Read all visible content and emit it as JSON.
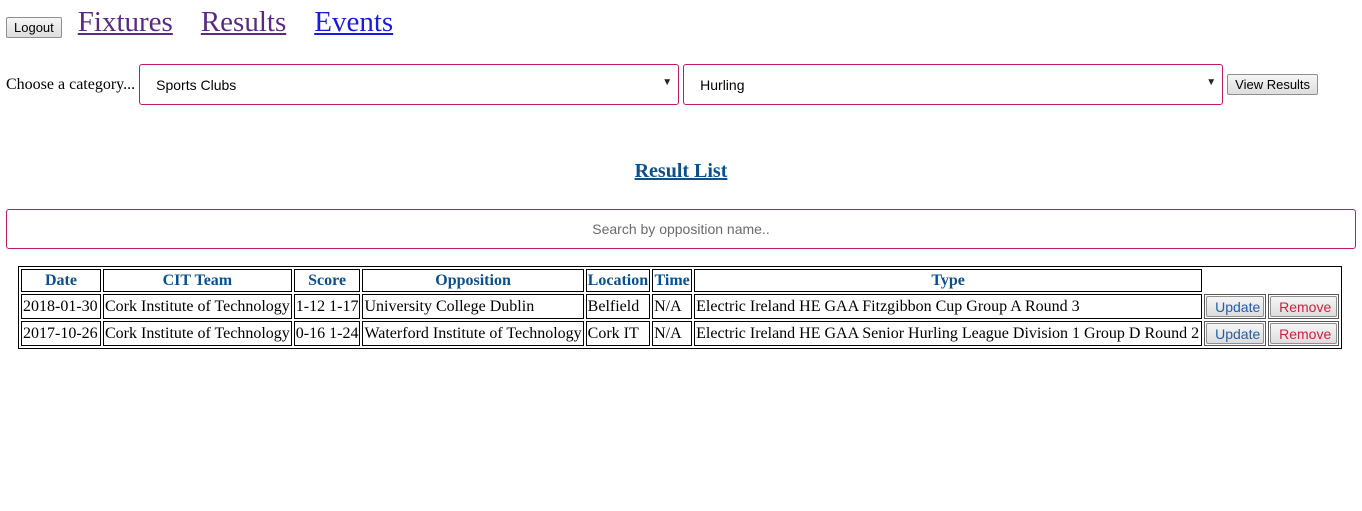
{
  "nav": {
    "logout_label": "Logout",
    "links": [
      "Fixtures",
      "Results",
      "Events"
    ]
  },
  "filters": {
    "label": "Choose a category...",
    "category_value": "Sports Clubs",
    "sport_value": "Hurling",
    "view_button": "View Results"
  },
  "results": {
    "title": "Result List",
    "search_placeholder": "Search by opposition name..",
    "columns": [
      "Date",
      "CIT Team",
      "Score",
      "Opposition",
      "Location",
      "Time",
      "Type"
    ],
    "rows": [
      {
        "date": "2018-01-30",
        "team": "Cork Institute of Technology",
        "score": "1-12 1-17",
        "opposition": "University College Dublin",
        "location": "Belfield",
        "time": "N/A",
        "type": "Electric Ireland HE GAA Fitzgibbon Cup Group A Round 3",
        "update_label": "Update",
        "remove_label": "Remove"
      },
      {
        "date": "2017-10-26",
        "team": "Cork Institute of Technology",
        "score": "0-16 1-24",
        "opposition": "Waterford Institute of Technology",
        "location": "Cork IT",
        "time": "N/A",
        "type": "Electric Ireland HE GAA Senior Hurling League Division 1 Group D Round 2",
        "update_label": "Update",
        "remove_label": "Remove"
      }
    ]
  },
  "colors": {
    "accent_border": "#c2186b",
    "header_blue": "#0c4f8a",
    "visited_link": "#5a2a82",
    "active_link": "#1a1adc",
    "remove_red": "#d0203f"
  }
}
